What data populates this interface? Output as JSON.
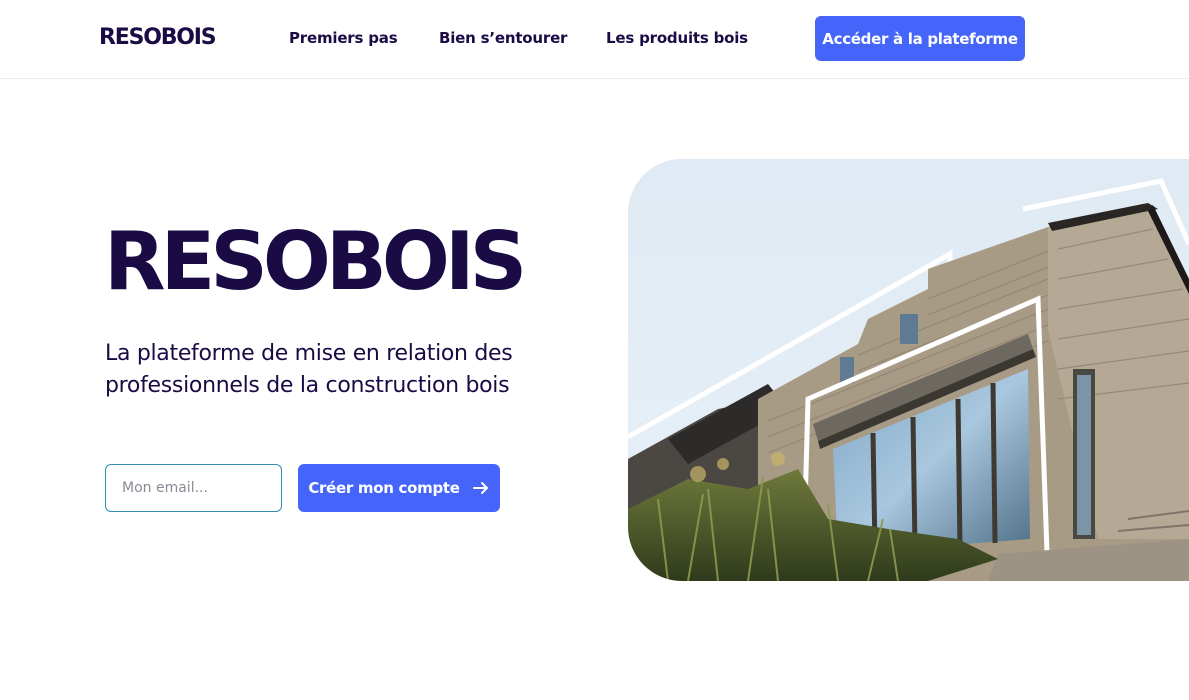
{
  "header": {
    "logo": "RESOBOIS",
    "nav": [
      {
        "label": "Premiers pas"
      },
      {
        "label": "Bien s’entourer"
      },
      {
        "label": "Les produits bois"
      }
    ],
    "cta_label": "Accéder à la plateforme"
  },
  "hero": {
    "title": "RESOBOIS",
    "subtitle": "La plateforme de mise en relation des professionnels de la construction bois",
    "email_placeholder": "Mon email...",
    "email_value": "",
    "create_account_label": "Créer mon compte",
    "create_account_icon": "arrow-right-icon",
    "image_subject": "wooden-house-photo"
  },
  "colors": {
    "brand_dark": "#1a0b45",
    "accent_blue": "#4565fa",
    "input_border": "#2f8fb8",
    "image_bg": "#e3eef7"
  }
}
